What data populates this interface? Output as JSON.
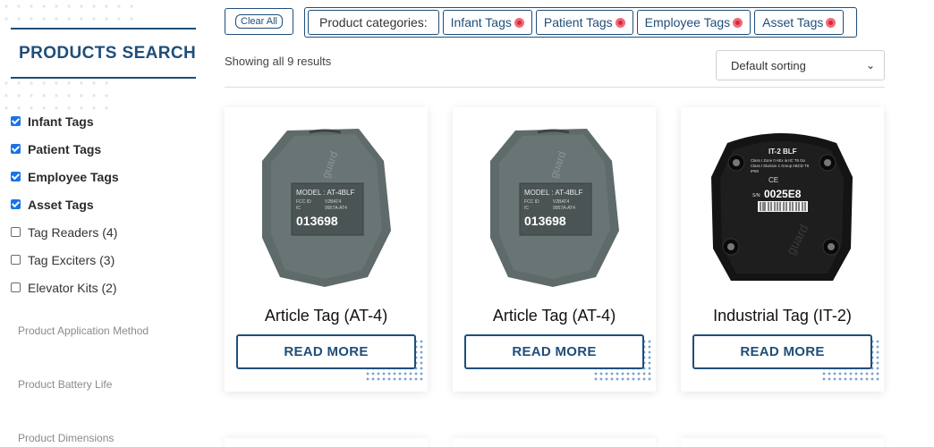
{
  "sidebar": {
    "title": "PRODUCTS SEARCH",
    "filters": [
      {
        "label": "Infant Tags",
        "checked": true
      },
      {
        "label": "Patient Tags",
        "checked": true
      },
      {
        "label": "Employee Tags",
        "checked": true
      },
      {
        "label": "Asset Tags",
        "checked": true
      },
      {
        "label": "Tag Readers (4)",
        "checked": false
      },
      {
        "label": "Tag Exciters (3)",
        "checked": false
      },
      {
        "label": "Elevator Kits (2)",
        "checked": false
      }
    ],
    "facets": [
      "Product Application Method",
      "Product Battery Life",
      "Product Dimensions"
    ]
  },
  "toolbar": {
    "clear_all": "Clear All",
    "categories_label": "Product categories:",
    "chips": [
      "Infant Tags",
      "Patient Tags",
      "Employee Tags",
      "Asset Tags"
    ],
    "results_text": "Showing all 9 results",
    "sort_value": "Default sorting"
  },
  "products": [
    {
      "title": "Article Tag (AT-4)",
      "button": "READ MORE",
      "device": {
        "model": "MODEL : AT-4BLF",
        "fcc": "FCC ID",
        "fcc_val": "V2BAT4",
        "ic": "IC",
        "ic_val": "9957A-AT4",
        "serial": "013698",
        "brand": "guard"
      }
    },
    {
      "title": "Article Tag (AT-4)",
      "button": "READ MORE",
      "device": {
        "model": "MODEL : AT-4BLF",
        "fcc": "FCC ID",
        "fcc_val": "V2BAT4",
        "ic": "IC",
        "ic_val": "9957A-AT4",
        "serial": "013698",
        "brand": "guard"
      }
    },
    {
      "title": "Industrial Tag (IT-2)",
      "button": "READ MORE",
      "device": {
        "model": "IT-2 BLF",
        "line1": "Class I Zone 0 AEx ia IIC T6 Ga",
        "line2": "Class I Division 1 Group ABCD T6",
        "line3": "IP68",
        "sn_label": "S/N:",
        "serial": "0025E8",
        "brand": "guard"
      }
    }
  ],
  "colors": {
    "brand": "#1f4e79",
    "checkbox": "#1a73e8",
    "chip_remove": "#d62839"
  }
}
